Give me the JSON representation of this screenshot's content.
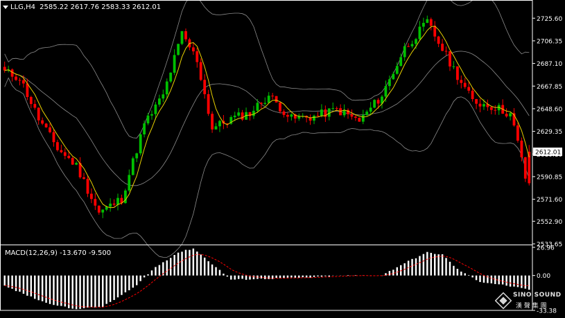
{
  "header": {
    "symbol_label": "LLG,H4",
    "ohlc": "2585.22 2617.76 2583.33 2612.01"
  },
  "price_axis": {
    "ticks": [
      "2725.60",
      "2706.35",
      "2687.10",
      "2667.85",
      "2648.60",
      "2629.35",
      "2610.10",
      "2590.85",
      "2571.60",
      "2552.90",
      "2533.65"
    ],
    "current_price": "2612.01"
  },
  "macd": {
    "label": "MACD(12,26,9) -13.670 -9.500",
    "ticks": [
      "26.96",
      "0.00",
      "-33.38"
    ]
  },
  "colors": {
    "background": "#000000",
    "bull": "#00c000",
    "bear": "#ff0000",
    "bands": "#8c8c8c",
    "ma": "#e8d000",
    "axis": "#ffffff",
    "macd_hist": "#ffffff",
    "macd_signal": "#ff0000"
  },
  "logo": {
    "name": "SINO SOUND",
    "chinese": "漢 聲 集 團"
  },
  "chart_data": [
    {
      "type": "candlestick",
      "title": "LLG,H4",
      "ylim": [
        2533.65,
        2734
      ],
      "bar_count": 140,
      "keypoints": [
        [
          0,
          2680
        ],
        [
          4,
          2675
        ],
        [
          9,
          2640
        ],
        [
          14,
          2615
        ],
        [
          19,
          2600
        ],
        [
          25,
          2560
        ],
        [
          31,
          2572
        ],
        [
          37,
          2635
        ],
        [
          42,
          2660
        ],
        [
          47,
          2712
        ],
        [
          51,
          2690
        ],
        [
          55,
          2632
        ],
        [
          60,
          2640
        ],
        [
          65,
          2645
        ],
        [
          70,
          2660
        ],
        [
          76,
          2640
        ],
        [
          82,
          2642
        ],
        [
          88,
          2648
        ],
        [
          94,
          2638
        ],
        [
          100,
          2660
        ],
        [
          106,
          2700
        ],
        [
          112,
          2722
        ],
        [
          118,
          2688
        ],
        [
          124,
          2655
        ],
        [
          130,
          2650
        ],
        [
          134,
          2644
        ],
        [
          136,
          2620
        ],
        [
          138,
          2590
        ],
        [
          139,
          2585
        ]
      ],
      "last_bar": {
        "open": 2612.01,
        "high": 2617.76,
        "low": 2583.33,
        "close": 2585.22
      },
      "overlays": [
        "Bollinger Bands",
        "Moving Average"
      ]
    },
    {
      "type": "bar",
      "title": "MACD(12,26,9)",
      "ylim": [
        -33.38,
        26.96
      ],
      "last_values": {
        "macd": -13.67,
        "signal": -9.5
      },
      "keypoints": [
        [
          0,
          -10
        ],
        [
          10,
          -25
        ],
        [
          18,
          -32
        ],
        [
          26,
          -30
        ],
        [
          34,
          -12
        ],
        [
          40,
          8
        ],
        [
          46,
          22
        ],
        [
          50,
          26
        ],
        [
          54,
          14
        ],
        [
          60,
          -4
        ],
        [
          70,
          -3
        ],
        [
          80,
          -2
        ],
        [
          90,
          0
        ],
        [
          100,
          0
        ],
        [
          106,
          12
        ],
        [
          112,
          22
        ],
        [
          116,
          20
        ],
        [
          120,
          6
        ],
        [
          126,
          -6
        ],
        [
          132,
          -9
        ],
        [
          139,
          -13.67
        ]
      ]
    }
  ]
}
